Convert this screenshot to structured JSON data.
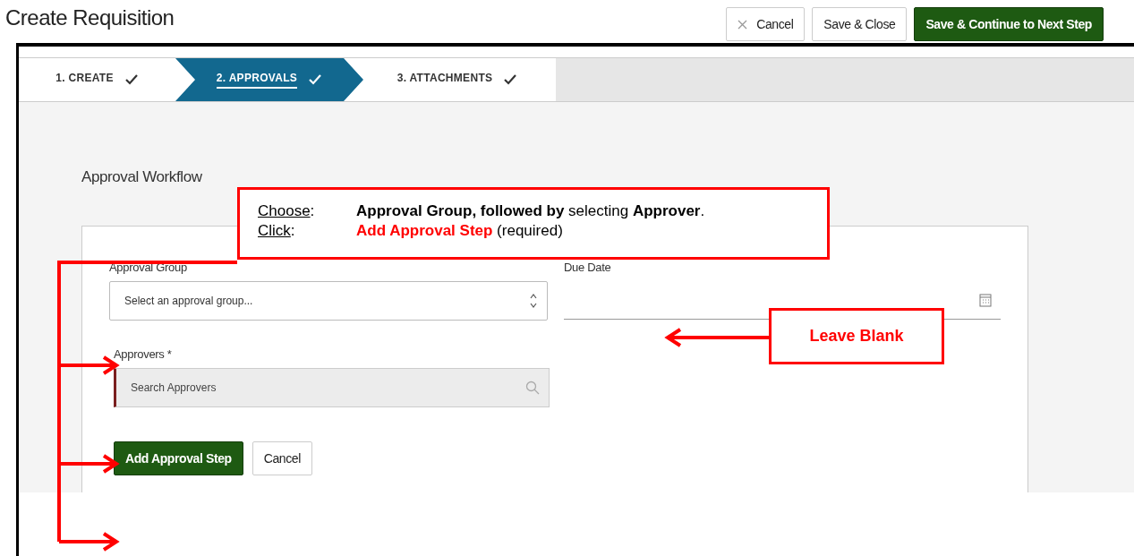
{
  "header": {
    "title": "Create Requisition",
    "buttons": [
      {
        "label": "Cancel",
        "kind": "cancel"
      },
      {
        "label": "Save & Close",
        "kind": "secondary"
      },
      {
        "label": "Save & Continue to Next Step",
        "kind": "primary"
      }
    ]
  },
  "steps": [
    {
      "label": "1. CREATE",
      "selected": false,
      "completed": true
    },
    {
      "label": "2. APPROVALS",
      "selected": true,
      "completed": true
    },
    {
      "label": "3. ATTACHMENTS",
      "selected": false,
      "completed": true
    }
  ],
  "section_title": "Approval Workflow",
  "form": {
    "approval_group": {
      "label": "Approval Group",
      "placeholder": "Select an approval group..."
    },
    "due_date": {
      "label": "Due Date"
    },
    "approvers": {
      "label": "Approvers *",
      "placeholder": "Search Approvers",
      "required": true
    },
    "buttons": [
      {
        "label": "Add Approval Step",
        "kind": "primary"
      },
      {
        "label": "Cancel",
        "kind": "secondary"
      }
    ]
  },
  "annotations": {
    "callout": [
      {
        "key": "Choose",
        "sep": ":",
        "text": "**Approval Group, followed by** selecting **Approver**."
      },
      {
        "key": "Click",
        "sep": ":",
        "action": "Add Approval Step",
        "text": " (required)"
      }
    ],
    "note": "Leave Blank"
  }
}
